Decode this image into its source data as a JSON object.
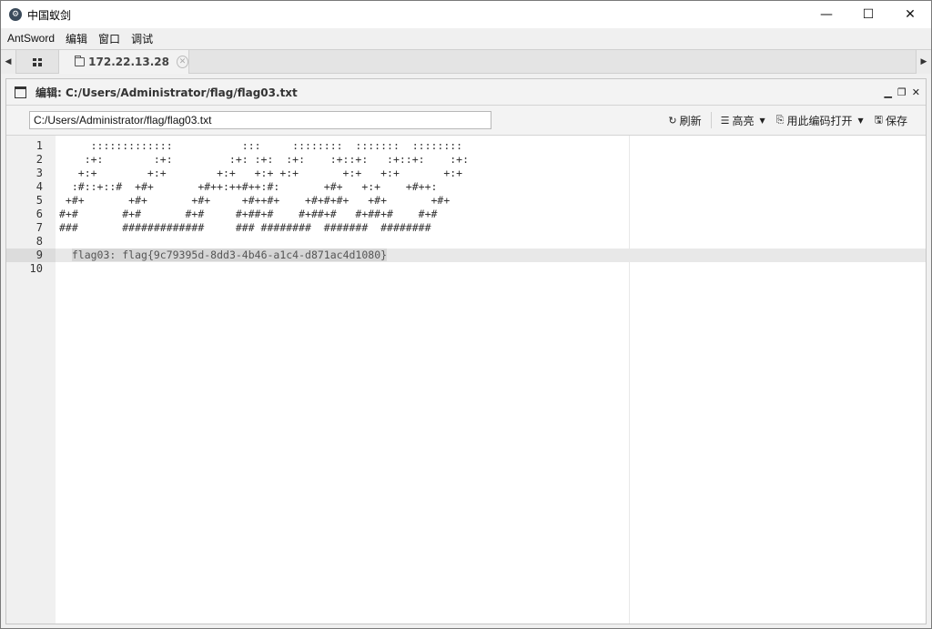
{
  "window": {
    "title": "中国蚁剑",
    "minimize": "—",
    "maximize": "☐",
    "close": "✕"
  },
  "menu": [
    "AntSword",
    "编辑",
    "窗口",
    "调试"
  ],
  "tabs": {
    "left_arrow": "◀",
    "right_arrow": "▶",
    "active_label": "172.22.13.28",
    "close": "✕"
  },
  "panel": {
    "title": "编辑: C:/Users/Administrator/flag/flag03.txt",
    "controls": [
      "▁",
      "❐",
      "✕"
    ]
  },
  "toolbar": {
    "path_value": "C:/Users/Administrator/flag/flag03.txt",
    "refresh_label": "刷新",
    "highlight_label": "高亮",
    "open_with_encoding_label": "用此编码打开",
    "save_label": "保存"
  },
  "editor": {
    "lines": [
      {
        "n": "1",
        "text": "     :::::::::::::           :::     ::::::::  :::::::  ::::::::"
      },
      {
        "n": "2",
        "text": "    :+:        :+:         :+: :+:  :+:    :+::+:   :+::+:    :+:"
      },
      {
        "n": "3",
        "text": "   +:+        +:+        +:+   +:+ +:+       +:+   +:+       +:+"
      },
      {
        "n": "4",
        "text": "  :#::+::#  +#+       +#++:++#++:#:       +#+   +:+    +#++:"
      },
      {
        "n": "5",
        "text": " +#+       +#+       +#+     +#++#+    +#+#+#+   +#+       +#+"
      },
      {
        "n": "6",
        "text": "#+#       #+#       #+#     #+##+#    #+##+#   #+##+#    #+#"
      },
      {
        "n": "7",
        "text": "###       #############     ### ########  #######  ########"
      },
      {
        "n": "8",
        "text": ""
      },
      {
        "n": "9",
        "text": "flag03: flag{9c79395d-8dd3-4b46-a1c4-d871ac4d1080}"
      },
      {
        "n": "10",
        "text": ""
      }
    ]
  }
}
